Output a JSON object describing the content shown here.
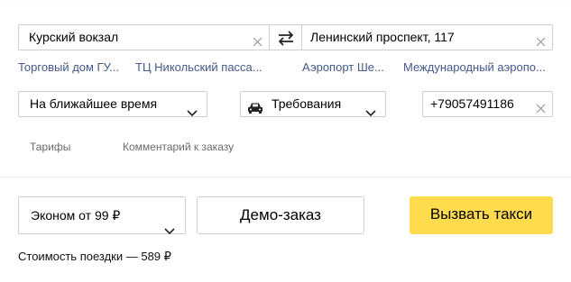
{
  "route": {
    "from_value": "Курский вокзал",
    "to_value": "Ленинский проспект, 117",
    "suggestions": [
      "Торговый дом ГУ...",
      "ТЦ Никольский пасса...",
      "Аэропорт Ше...",
      "Международный аэропо..."
    ]
  },
  "options": {
    "time_select": "На ближайшее время",
    "requirements_select": "Требования",
    "phone_value": "+79057491186"
  },
  "tabs": {
    "tariffs": "Тарифы",
    "comment": "Комментарий к заказу"
  },
  "order": {
    "tariff_select": "Эконом от 99 ₽",
    "demo_button": "Демо-заказ",
    "call_button": "Вызвать такси",
    "price_text": "Стоимость поездки — 589 ₽"
  },
  "colors": {
    "accent_yellow": "#ffdb4d",
    "link_blue": "#44598a"
  },
  "icons": {
    "clear": "close-icon",
    "swap": "swap-arrows-icon",
    "car": "car-icon",
    "chevron": "chevron-down-icon"
  }
}
